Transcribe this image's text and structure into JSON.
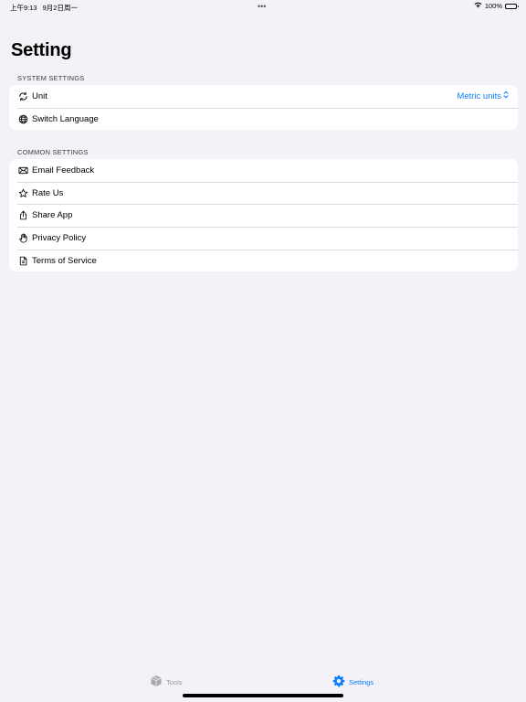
{
  "status_bar": {
    "time": "上午9:13",
    "date": "9月2日周一",
    "dots": "•••",
    "battery": "100%"
  },
  "page": {
    "title": "Setting"
  },
  "system_settings": {
    "header": "SYSTEM SETTINGS",
    "unit_label": "Unit",
    "unit_value": "Metric units",
    "language_label": "Switch Language"
  },
  "common_settings": {
    "header": "COMMON SETTINGS",
    "items": [
      {
        "label": "Email Feedback",
        "icon": "envelope-icon"
      },
      {
        "label": "Rate Us",
        "icon": "star-icon"
      },
      {
        "label": "Share App",
        "icon": "share-icon"
      },
      {
        "label": "Privacy Policy",
        "icon": "hand-icon"
      },
      {
        "label": "Terms of Service",
        "icon": "document-icon"
      }
    ]
  },
  "tab_bar": {
    "tools_label": "Tools",
    "settings_label": "Settings",
    "active": "Settings"
  },
  "colors": {
    "accent": "#0a7cff",
    "background": "#f2f2f7"
  }
}
